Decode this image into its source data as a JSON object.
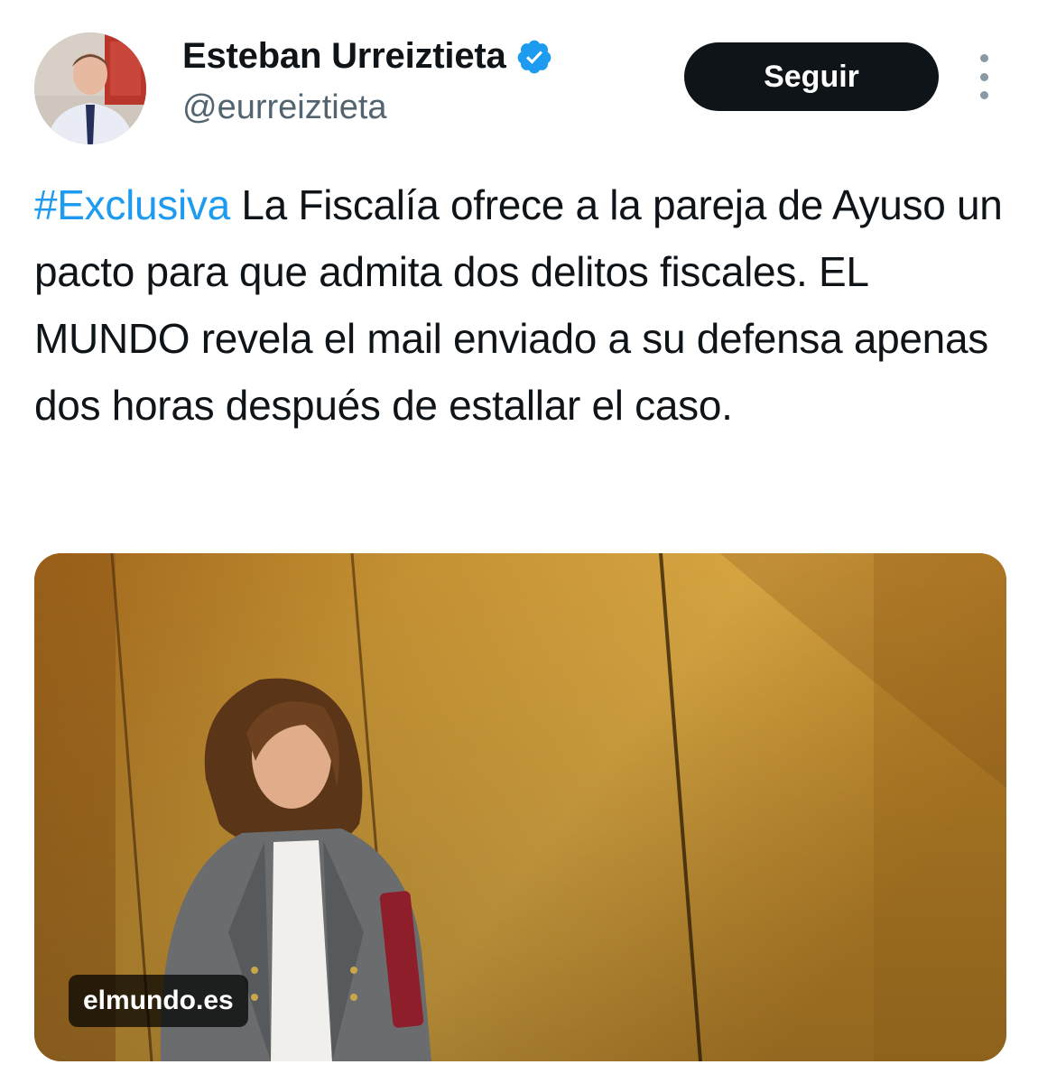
{
  "author": {
    "display_name": "Esteban Urreiztieta",
    "handle": "@eurreiztieta",
    "verified": true,
    "avatar_icon": "profile-photo"
  },
  "actions": {
    "follow_label": "Seguir",
    "more_icon": "more-vertical-icon"
  },
  "tweet": {
    "hashtag": "#Exclusiva",
    "text": " La Fiscalía ofrece a la pareja de Ayuso un pacto para que admita dos delitos fiscales. EL MUNDO revela el mail enviado a su defensa apenas dos horas después de estallar el caso."
  },
  "link_card": {
    "source_domain": "elmundo.es"
  },
  "colors": {
    "link": "#1d9bf0",
    "verified": "#1d9bf0",
    "follow_button_bg": "#0f1419",
    "text_primary": "#0f1419",
    "text_secondary": "#536471"
  }
}
